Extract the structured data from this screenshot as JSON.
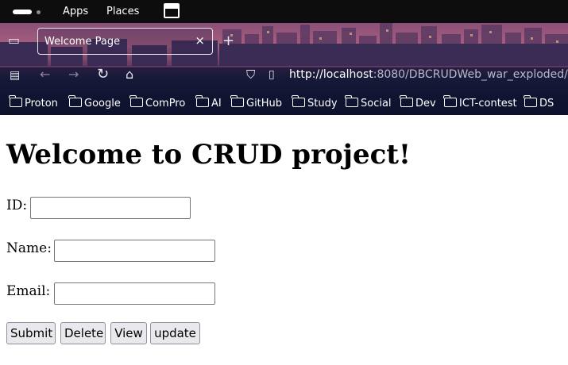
{
  "topbar": {
    "menu_apps": "Apps",
    "menu_places": "Places"
  },
  "browser": {
    "tab_title": "Welcome Page",
    "tab_close": "×",
    "new_tab": "+",
    "url_host": "http://localhost",
    "url_rest": ":8080/DBCRUDWeb_war_exploded/",
    "bookmarks": [
      "Proton",
      "Google",
      "ComPro",
      "AI",
      "GitHub",
      "Study",
      "Social",
      "Dev",
      "ICT-contest",
      "DS"
    ]
  },
  "page": {
    "heading": "Welcome to CRUD project!",
    "fields": {
      "id_label": "ID:",
      "id_value": "",
      "name_label": "Name:",
      "name_value": "",
      "email_label": "Email:",
      "email_value": ""
    },
    "buttons": {
      "submit": "Submit",
      "delete": "Delete",
      "view": "View",
      "update": "update"
    }
  },
  "colors": {
    "topbar": "#0d0d0d",
    "button_bg": "#e9e9ed",
    "button_border": "#8f8f9d"
  }
}
